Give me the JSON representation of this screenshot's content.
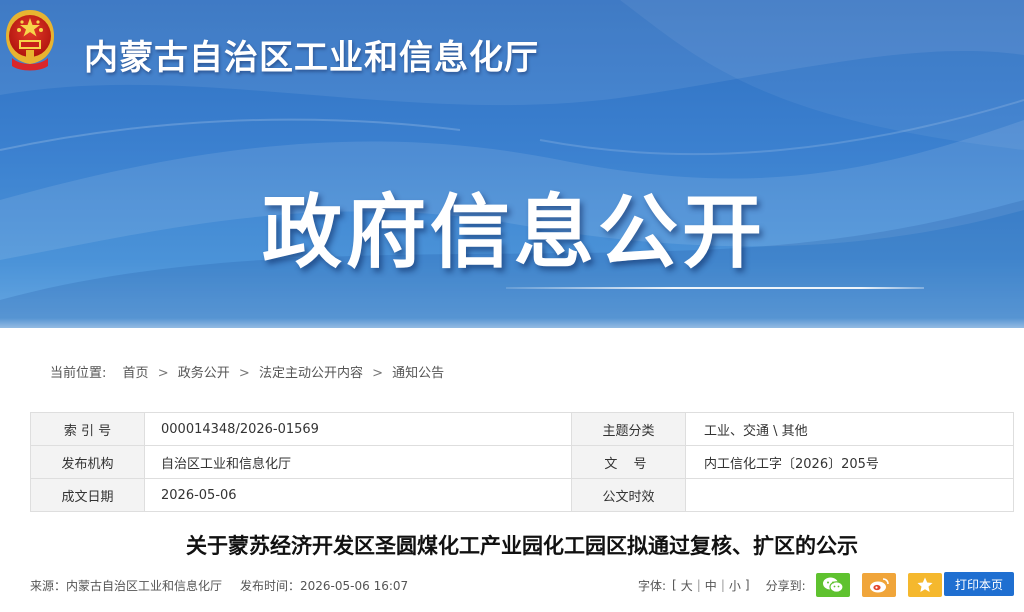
{
  "header": {
    "site_title": "内蒙古自治区工业和信息化厅",
    "section_title": "政府信息公开"
  },
  "breadcrumb": {
    "label": "当前位置:",
    "items": [
      "首页",
      "政务公开",
      "法定主动公开内容",
      "通知公告"
    ],
    "separator": ">"
  },
  "info": {
    "index_label": "索 引 号",
    "index_value": "000014348/2026-01569",
    "topic_label": "主题分类",
    "topic_value": "工业、交通 \\ 其他",
    "publisher_label": "发布机构",
    "publisher_value": "自治区工业和信息化厅",
    "doc_no_label": "文 号",
    "doc_no_value": "内工信化工字〔2026〕205号",
    "date_label": "成文日期",
    "date_value": "2026-05-06",
    "effect_label": "公文时效",
    "effect_value": ""
  },
  "article": {
    "title": "关于蒙苏经济开发区圣圆煤化工产业园化工园区拟通过复核、扩区的公示"
  },
  "meta": {
    "source": "来源：内蒙古自治区工业和信息化厅",
    "published": "发布时间：2026-05-06 16:07",
    "font_label": "字体:",
    "font_open": "[",
    "font_large": "大",
    "font_medium": "中",
    "font_small": "小",
    "font_close": "]",
    "share_label": "分享到:",
    "print_label": "打印本页"
  },
  "colors": {
    "banner_top": "#2f6fc0",
    "banner_bottom": "#6aa9e2",
    "wechat": "#5fc22f",
    "weibo": "#f0a53a",
    "favorite": "#f5b82e",
    "print": "#1f6fd1"
  },
  "icons": {
    "emblem": "national-emblem-icon",
    "wechat": "wechat-icon",
    "weibo": "weibo-icon",
    "favorite": "star-icon"
  }
}
